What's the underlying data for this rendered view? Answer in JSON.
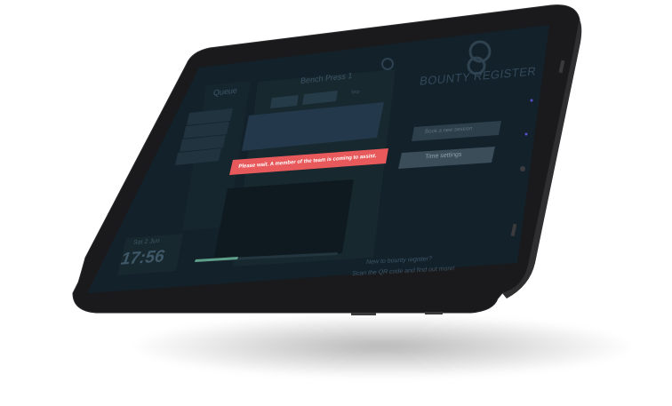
{
  "screen": {
    "queue_title": "Queue",
    "machine_title": "Bench Press 1",
    "brand_name": "BOUNTY REGISTER",
    "brand_logo_letters": "BR",
    "alert_text": "Please wait. A member of the team is coming to assist.",
    "settings_button": "Time settings",
    "option_button": "Book a new session",
    "date_text": "Sat 2 Jun",
    "time_text": "17:56",
    "footer_line1": "New to bounty register?",
    "footer_line2": "Scan the QR code and find out more!",
    "tabs": [
      "",
      "",
      "Skip"
    ]
  },
  "colors": {
    "bezel": "#1b1b1d",
    "screen_bg": "#15222c",
    "panel": "#1c2f3b",
    "alert": "#e8595b",
    "accent": "#5fa08b"
  }
}
